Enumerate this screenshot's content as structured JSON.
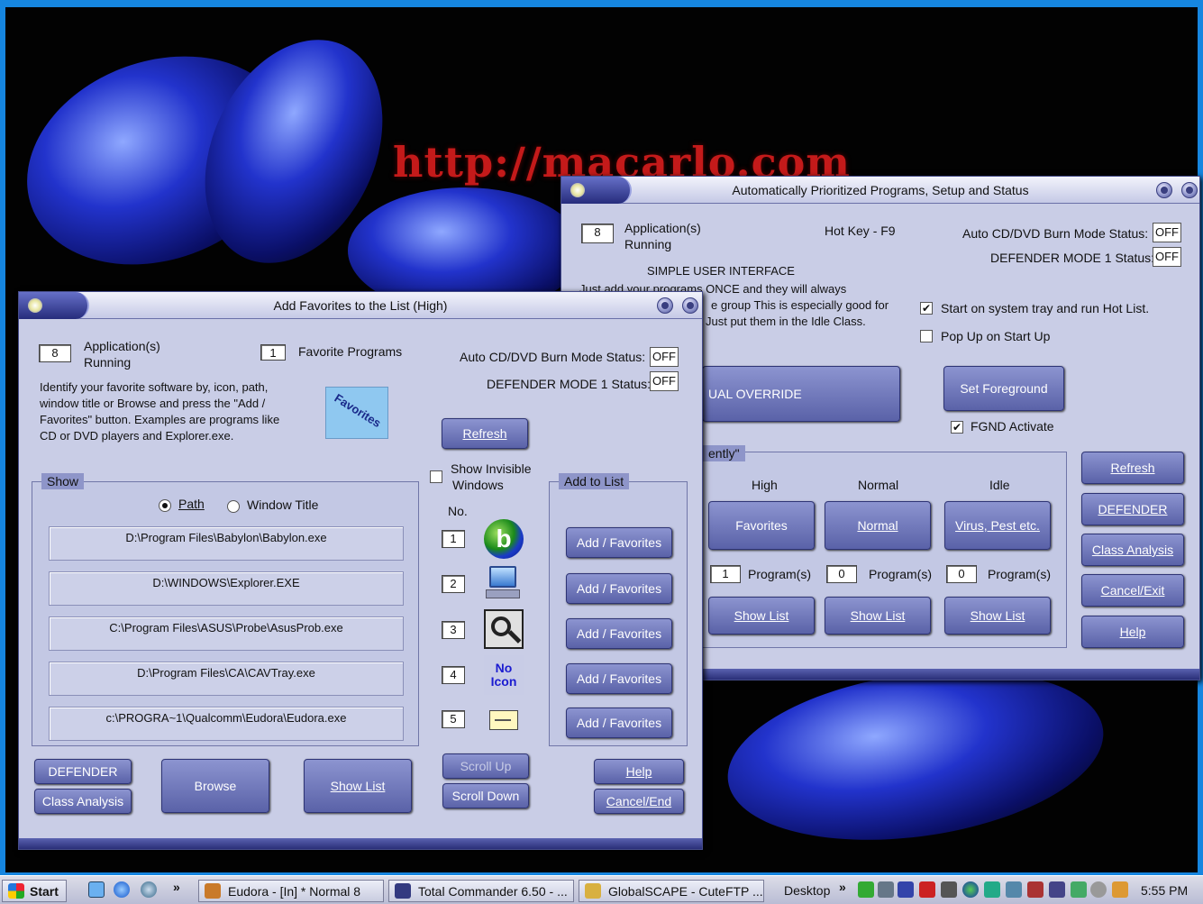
{
  "wallpaper": {
    "url_text": "http://macarlo.com"
  },
  "main_window": {
    "title": "Automatically Prioritized Programs, Setup and Status",
    "app_count": "8",
    "app_label_1": "Application(s)",
    "app_label_2": "Running",
    "hotkey": "Hot Key - F9",
    "burn_label": "Auto CD/DVD Burn Mode Status:",
    "burn_value": "OFF",
    "defender_label": "DEFENDER MODE 1 Status:",
    "defender_value": "OFF",
    "simple_heading": "SIMPLE USER INTERFACE",
    "simple_l1": "Just add your programs ONCE and they will always",
    "simple_l2": "e group This is especially good for",
    "simple_l3": "Just put them in the Idle Class.",
    "tray_label": "Start on system tray and run Hot List.",
    "popup_label": "Pop Up on Start Up",
    "override_btn": "UAL OVERRIDE",
    "setfg_btn": "Set Foreground",
    "fgnd_label": "FGND Activate",
    "group_label": "ently\"",
    "col_high": "High",
    "col_normal": "Normal",
    "col_idle": "Idle",
    "btn_favorites": "Favorites",
    "btn_normal": "Normal",
    "btn_virus": "Virus, Pest etc.",
    "high_count": "1",
    "normal_count": "0",
    "idle_count": "0",
    "programs_label": "Program(s)",
    "show_list": "Show List",
    "right_btns": [
      "Refresh",
      "DEFENDER",
      "Class Analysis",
      "Cancel/Exit",
      "Help"
    ]
  },
  "fav_window": {
    "title": "Add Favorites to the List (High)",
    "app_count": "8",
    "app_label_1": "Application(s)",
    "app_label_2": "Running",
    "fav_count": "1",
    "fav_label": "Favorite Programs",
    "burn_label": "Auto CD/DVD Burn Mode Status:",
    "burn_value": "OFF",
    "defender_label": "DEFENDER MODE 1 Status:",
    "defender_value": "OFF",
    "instr_1": "Identify your favorite software by, icon, path,",
    "instr_2": "window title or Browse and press the \"Add /",
    "instr_3": "Favorites\" button. Examples are programs like",
    "instr_4": "CD or DVD players and Explorer.exe.",
    "logo_text": "Favorites",
    "refresh_btn": "Refresh",
    "show_label": "Show",
    "path_label": "Path",
    "wtitle_label": "Window Title",
    "invisible_1": "Show Invisible",
    "invisible_2": "Windows",
    "no_label": "No.",
    "add_group_label": "Add to List",
    "rows": [
      {
        "path": "D:\\Program Files\\Babylon\\Babylon.exe",
        "no": "1"
      },
      {
        "path": "D:\\WINDOWS\\Explorer.EXE",
        "no": "2"
      },
      {
        "path": "C:\\Program Files\\ASUS\\Probe\\AsusProb.exe",
        "no": "3"
      },
      {
        "path": "D:\\Program Files\\CA\\CAVTray.exe",
        "no": "4"
      },
      {
        "path": "c:\\PROGRA~1\\Qualcomm\\Eudora\\Eudora.exe",
        "no": "5"
      }
    ],
    "no_icon_1": "No",
    "no_icon_2": "Icon",
    "add_btn": "Add / Favorites",
    "defender_btn": "DEFENDER",
    "class_btn": "Class Analysis",
    "browse_btn": "Browse",
    "showlist_btn": "Show List",
    "scrollup_btn": "Scroll Up",
    "scrolldown_btn": "Scroll Down",
    "help_btn": "Help",
    "cancel_btn": "Cancel/End"
  },
  "taskbar": {
    "start": "Start",
    "chevron": "»",
    "tasks": [
      "Eudora - [In] * Normal 8",
      "Total Commander 6.50 - ...",
      "GlobalSCAPE - CuteFTP ..."
    ],
    "desktop": "Desktop",
    "clock": "5:55 PM"
  }
}
